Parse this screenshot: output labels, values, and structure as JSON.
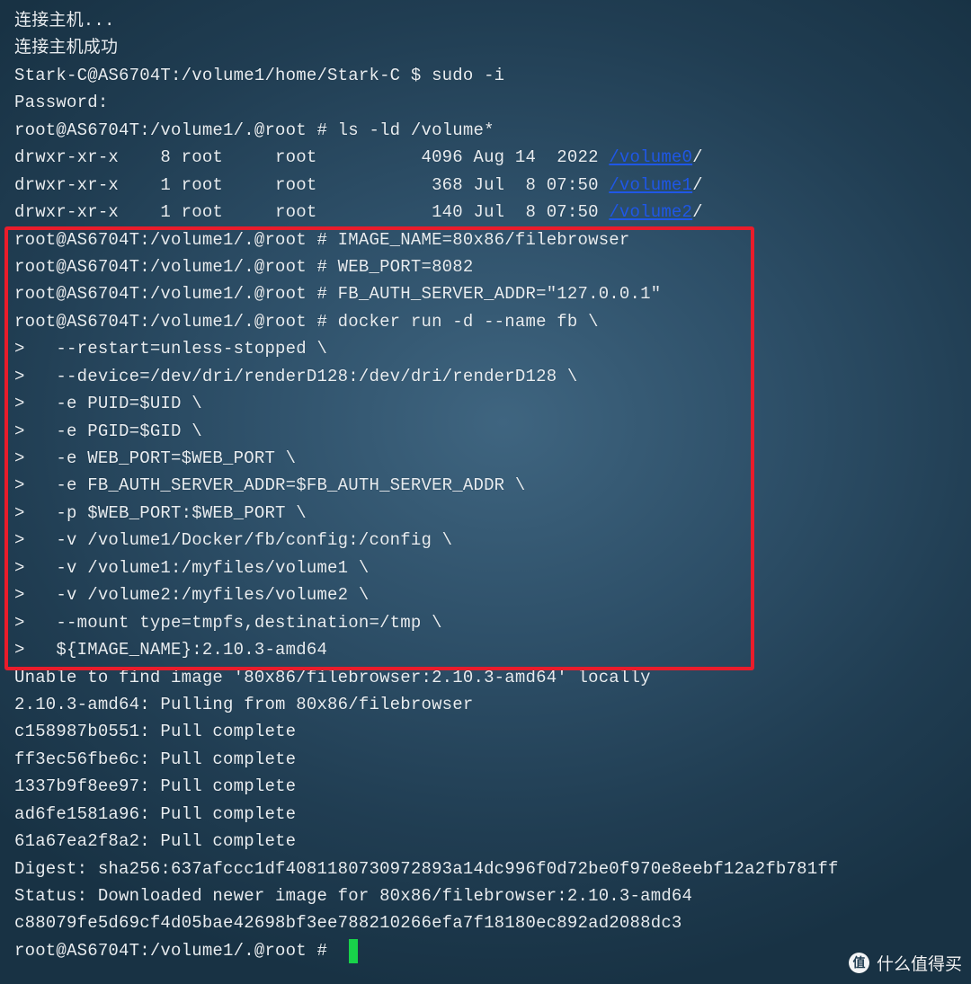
{
  "terminal": {
    "lines": [
      "连接主机...",
      "连接主机成功",
      "Stark-C@AS6704T:/volume1/home/Stark-C $ sudo -i",
      "Password:",
      "root@AS6704T:/volume1/.@root # ls -ld /volume*"
    ],
    "ls_rows": [
      {
        "prefix": "drwxr-xr-x    8 root     root          4096 Aug 14  2022 ",
        "link": "/volume0",
        "suffix": "/"
      },
      {
        "prefix": "drwxr-xr-x    1 root     root           368 Jul  8 07:50 ",
        "link": "/volume1",
        "suffix": "/"
      },
      {
        "prefix": "drwxr-xr-x    1 root     root           140 Jul  8 07:50 ",
        "link": "/volume2",
        "suffix": "/"
      }
    ],
    "command_block": [
      "root@AS6704T:/volume1/.@root # IMAGE_NAME=80x86/filebrowser",
      "root@AS6704T:/volume1/.@root # WEB_PORT=8082",
      "root@AS6704T:/volume1/.@root # FB_AUTH_SERVER_ADDR=\"127.0.0.1\"",
      "root@AS6704T:/volume1/.@root # docker run -d --name fb \\",
      ">   --restart=unless-stopped \\",
      ">   --device=/dev/dri/renderD128:/dev/dri/renderD128 \\",
      ">   -e PUID=$UID \\",
      ">   -e PGID=$GID \\",
      ">   -e WEB_PORT=$WEB_PORT \\",
      ">   -e FB_AUTH_SERVER_ADDR=$FB_AUTH_SERVER_ADDR \\",
      ">   -p $WEB_PORT:$WEB_PORT \\",
      ">   -v /volume1/Docker/fb/config:/config \\",
      ">   -v /volume1:/myfiles/volume1 \\",
      ">   -v /volume2:/myfiles/volume2 \\",
      ">   --mount type=tmpfs,destination=/tmp \\",
      ">   ${IMAGE_NAME}:2.10.3-amd64"
    ],
    "output_lines": [
      "Unable to find image '80x86/filebrowser:2.10.3-amd64' locally",
      "2.10.3-amd64: Pulling from 80x86/filebrowser",
      "c158987b0551: Pull complete",
      "ff3ec56fbe6c: Pull complete",
      "1337b9f8ee97: Pull complete",
      "ad6fe1581a96: Pull complete",
      "61a67ea2f8a2: Pull complete",
      "Digest: sha256:637afccc1df4081180730972893a14dc996f0d72be0f970e8eebf12a2fb781ff",
      "Status: Downloaded newer image for 80x86/filebrowser:2.10.3-amd64",
      "c88079fe5d69cf4d05bae42698bf3ee788210266efa7f18180ec892ad2088dc3"
    ],
    "final_prompt": "root@AS6704T:/volume1/.@root # "
  },
  "colors": {
    "text": "#e8edf1",
    "link": "#1f57e6",
    "highlight_border": "#ea1c2b",
    "cursor": "#18d34a"
  },
  "watermark": {
    "logo_glyph": "值",
    "text": "什么值得买"
  }
}
